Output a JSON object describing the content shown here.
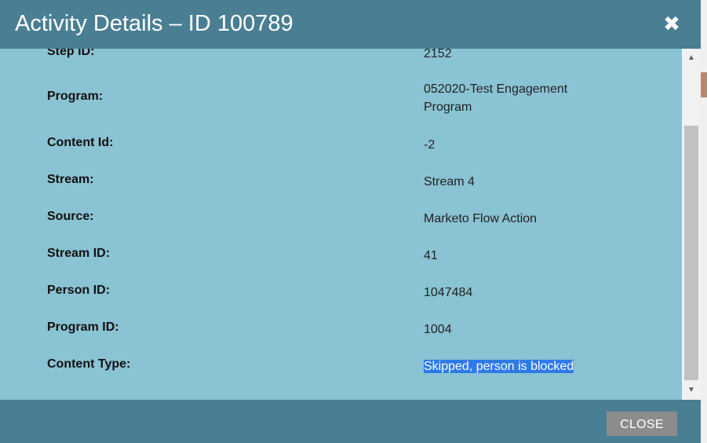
{
  "dialog": {
    "title": "Activity Details – ID 100789",
    "close_icon": "✖",
    "close_button_label": "CLOSE"
  },
  "details": [
    {
      "label": "Step ID:",
      "value": "2152"
    },
    {
      "label": "Program:",
      "value": "052020-Test Engagement Program"
    },
    {
      "label": "Content Id:",
      "value": "-2"
    },
    {
      "label": "Stream:",
      "value": "Stream 4"
    },
    {
      "label": "Source:",
      "value": "Marketo Flow Action"
    },
    {
      "label": "Stream ID:",
      "value": "41"
    },
    {
      "label": "Person ID:",
      "value": "1047484"
    },
    {
      "label": "Program ID:",
      "value": "1004"
    },
    {
      "label": "Content Type:",
      "value": "Skipped, person is blocked"
    }
  ],
  "scrollbar": {
    "up_icon": "▲",
    "down_icon": "▼"
  },
  "colors": {
    "header_bg": "#4a7f93",
    "content_bg": "#8ac3d3",
    "selection": "#2e7ae6",
    "button_bg": "#8c8c8c"
  }
}
